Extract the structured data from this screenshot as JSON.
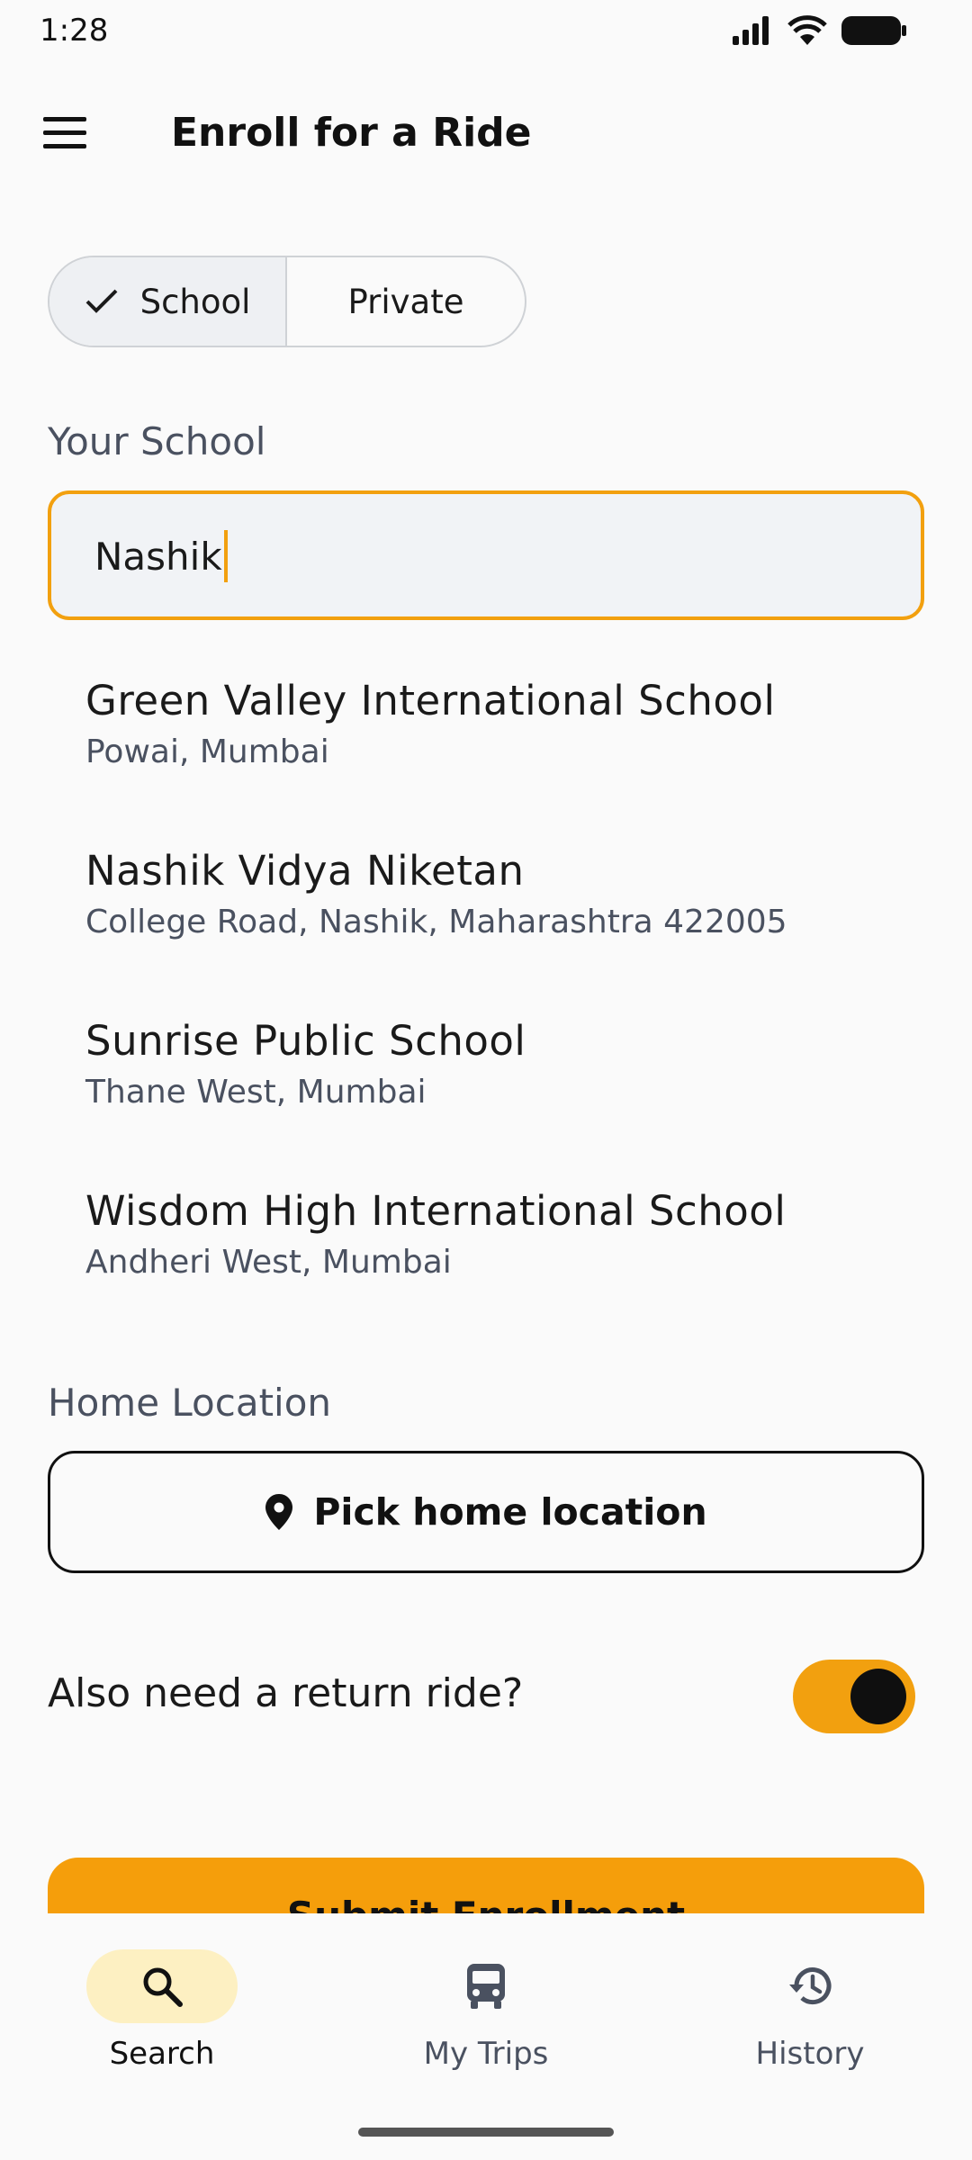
{
  "status_bar": {
    "time": "1:28",
    "icons": [
      "signal-icon",
      "wifi-icon",
      "battery-icon"
    ]
  },
  "app_bar": {
    "title": "Enroll for a Ride",
    "menu_icon": "menu-icon"
  },
  "ride_type": {
    "options": [
      {
        "label": "School",
        "selected": true
      },
      {
        "label": "Private",
        "selected": false
      }
    ]
  },
  "school": {
    "label": "Your School",
    "input_value": "Nashik",
    "suggestions": [
      {
        "name": "Green Valley International School",
        "address": "Powai, Mumbai"
      },
      {
        "name": "Nashik Vidya Niketan",
        "address": "College Road, Nashik, Maharashtra 422005"
      },
      {
        "name": "Sunrise Public School",
        "address": "Thane West, Mumbai"
      },
      {
        "name": "Wisdom High International School",
        "address": "Andheri West, Mumbai"
      }
    ]
  },
  "home": {
    "label": "Home Location",
    "button_label": "Pick home location"
  },
  "return_ride": {
    "label": "Also need a return ride?",
    "enabled": true
  },
  "submit": {
    "label": "Submit Enrollment"
  },
  "bottom_nav": {
    "items": [
      {
        "label": "Search",
        "icon": "search-icon",
        "active": true
      },
      {
        "label": "My Trips",
        "icon": "bus-icon",
        "active": false
      },
      {
        "label": "History",
        "icon": "history-icon",
        "active": false
      }
    ]
  },
  "colors": {
    "accent": "#f59e0b",
    "accent_focus": "#f2a00f",
    "nav_active_bg": "#fdf0c2",
    "background": "#fafafa"
  }
}
